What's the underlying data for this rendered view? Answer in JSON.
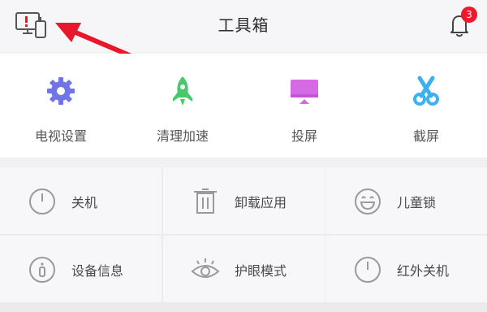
{
  "header": {
    "title": "工具箱",
    "notification_count": "3",
    "left_icon": "device-alert-icon",
    "right_icon": "bell-icon"
  },
  "quick_tools": [
    {
      "label": "电视设置",
      "icon": "gear-icon",
      "color": "#6f74e6"
    },
    {
      "label": "清理加速",
      "icon": "rocket-icon",
      "color": "#48c86b"
    },
    {
      "label": "投屏",
      "icon": "screen-cast-icon",
      "color": "#d56ae4"
    },
    {
      "label": "截屏",
      "icon": "scissors-icon",
      "color": "#3fb0ef"
    }
  ],
  "grid_tools": [
    {
      "label": "关机",
      "icon": "power-icon"
    },
    {
      "label": "卸载应用",
      "icon": "trash-icon"
    },
    {
      "label": "儿童锁",
      "icon": "smiley-icon"
    },
    {
      "label": "设备信息",
      "icon": "info-icon"
    },
    {
      "label": "护眼模式",
      "icon": "eye-icon"
    },
    {
      "label": "红外关机",
      "icon": "power-icon"
    }
  ],
  "colors": {
    "badge": "#f0192b",
    "arrow": "#e8182a",
    "background": "#f1f1f3"
  }
}
